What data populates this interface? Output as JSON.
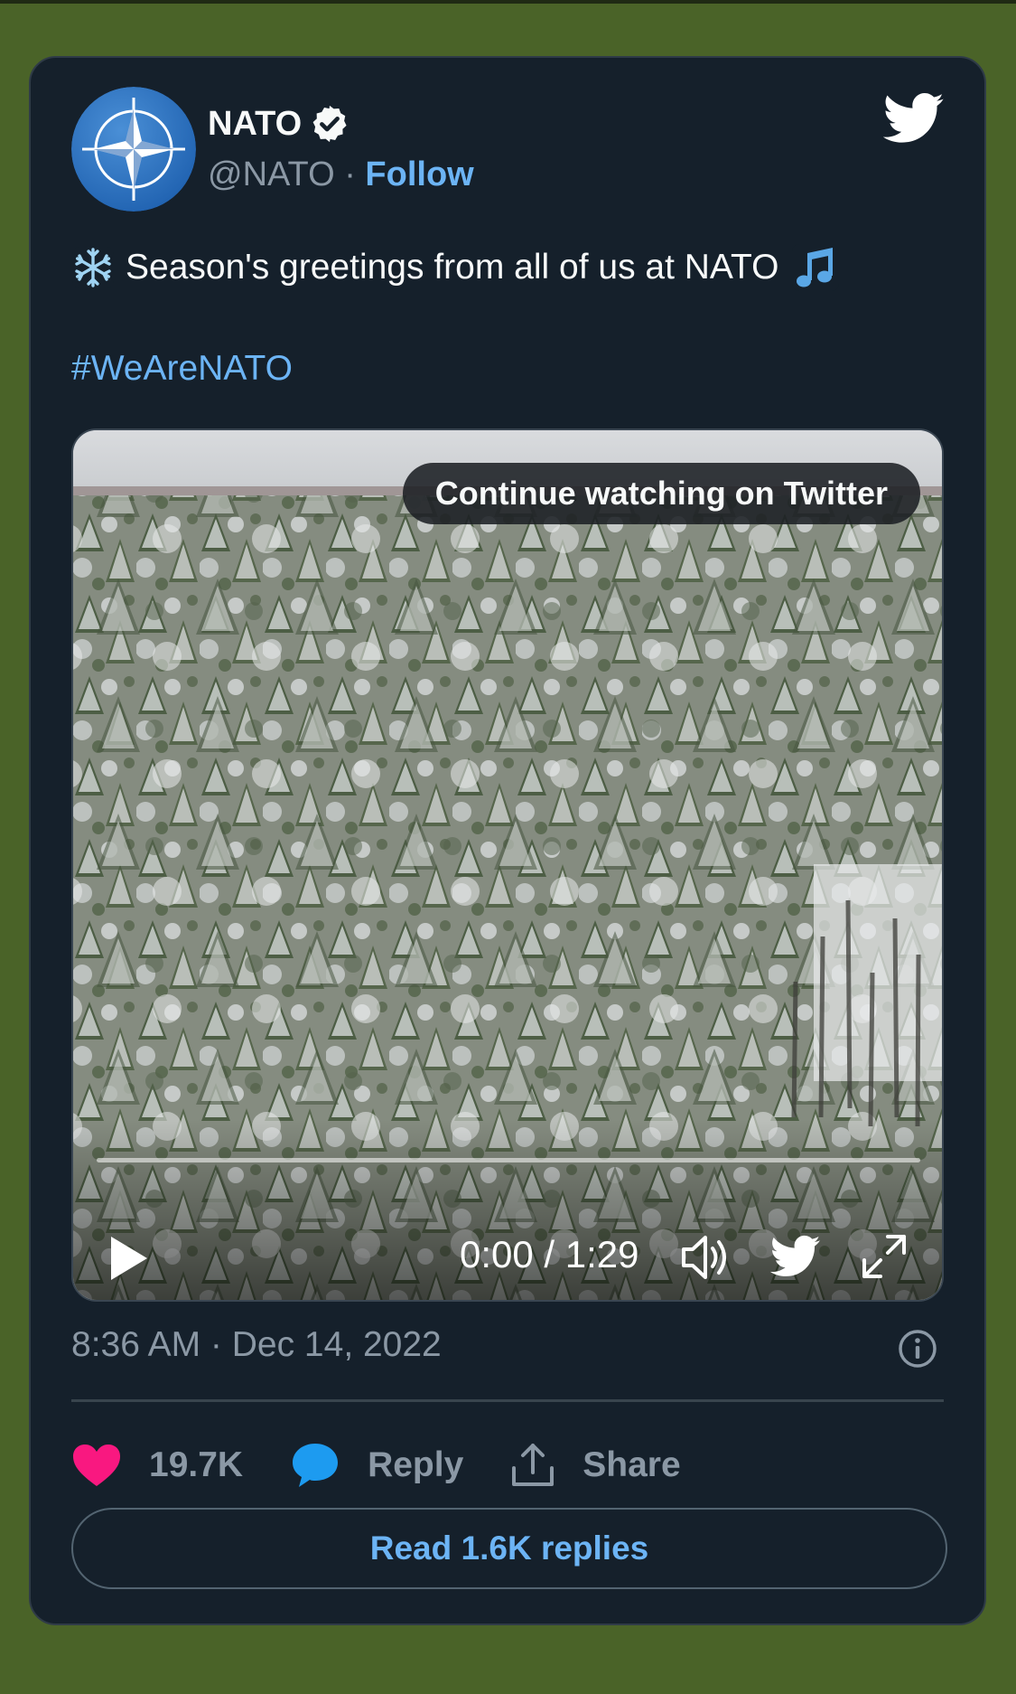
{
  "tweet": {
    "author": {
      "name": "NATO",
      "handle": "@NATO",
      "separator": "·",
      "follow_label": "Follow"
    },
    "text": "Season's greetings from all of us at NATO",
    "hashtag": "#WeAreNATO",
    "timestamp": "8:36 AM · Dec 14, 2022"
  },
  "video": {
    "overlay_label": "Continue watching on Twitter",
    "time": "0:00 / 1:29",
    "progress": 0
  },
  "actions": {
    "like_count": "19.7K",
    "reply_label": "Reply",
    "share_label": "Share",
    "read_replies_label": "Read 1.6K replies"
  },
  "icons": {
    "avatar": "nato-compass-star-icon",
    "verified": "verified-badge-icon",
    "logo": "twitter-bird-icon",
    "snowflake": "snowflake-icon",
    "music": "music-note-icon",
    "play": "play-icon",
    "volume": "volume-icon",
    "fullscreen": "fullscreen-icon",
    "info": "info-icon",
    "like": "heart-icon",
    "reply": "speech-bubble-icon",
    "share": "share-icon"
  },
  "colors": {
    "page_background": "#4a6328",
    "card_background": "#15202b",
    "accent": "#6cb4f5",
    "like": "#f91880"
  }
}
